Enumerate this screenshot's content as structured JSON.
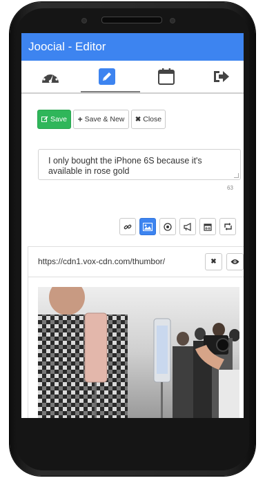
{
  "app": {
    "title": "Joocial - Editor"
  },
  "tabs": [
    {
      "icon": "dashboard-icon",
      "active": false
    },
    {
      "icon": "pencil-icon",
      "active": true
    },
    {
      "icon": "calendar-icon",
      "active": false
    },
    {
      "icon": "logout-icon",
      "active": false
    }
  ],
  "toolbar": {
    "save_label": "Save",
    "save_new_label": "Save & New",
    "close_label": "Close"
  },
  "message": {
    "text": "I only bought the iPhone 6S because it's available in rose gold",
    "char_count": "63"
  },
  "media_tools": [
    "link-icon",
    "image-icon",
    "target-icon",
    "megaphone-icon",
    "calendar-icon",
    "retweet-icon"
  ],
  "image_panel": {
    "url": "https://cdn1.vox-cdn.com/thumbor/"
  },
  "colors": {
    "appbar": "#3d84f0",
    "save_button": "#2fb65a",
    "active_tool": "#3d84f0"
  }
}
